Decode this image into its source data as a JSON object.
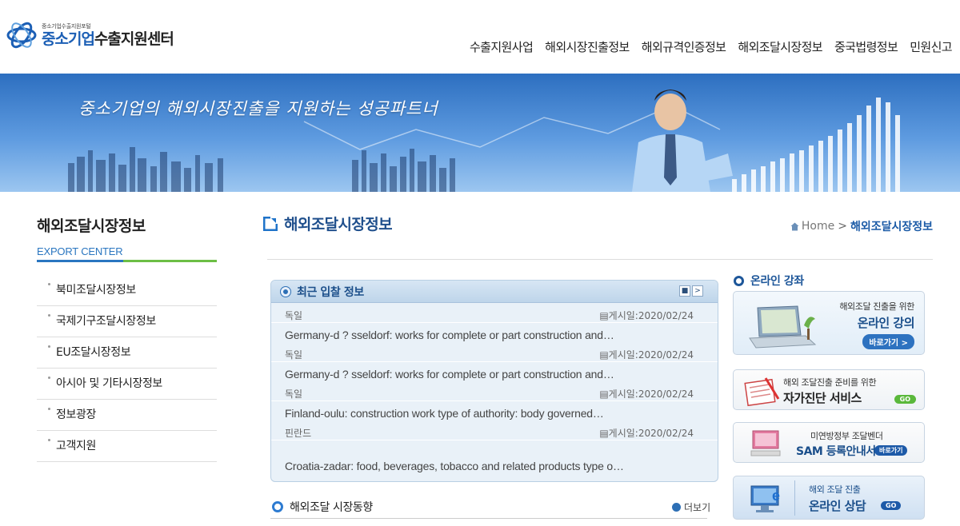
{
  "header": {
    "logo_small": "중소기업수출지원포털",
    "logo_main_1": "중소기업",
    "logo_main_2": "수출지원센터",
    "nav": [
      "수출지원사업",
      "해외시장진출정보",
      "해외규격인증정보",
      "해외조달시장정보",
      "중국법령정보",
      "민원신고"
    ]
  },
  "banner": {
    "slogan": "중소기업의 해외시장진출을 지원하는 성공파트너"
  },
  "sidebar": {
    "title": "해외조달시장정보",
    "subtitle": "EXPORT CENTER",
    "items": [
      "북미조달시장정보",
      "국제기구조달시장정보",
      "EU조달시장정보",
      "아시아 및 기타시장정보",
      "정보광장",
      "고객지원"
    ]
  },
  "content": {
    "title": "해외조달시장정보",
    "breadcrumb_home": "Home",
    "breadcrumb_current": "해외조달시장정보"
  },
  "bids": {
    "title": "최근 입찰 정보",
    "ctrl_stop": "■",
    "ctrl_next": ">",
    "rows": [
      {
        "country": "독일",
        "date": "게시일:2020/02/24"
      },
      {
        "title": "Germany-d ? sseldorf: works for complete or part construction and…",
        "country": "독일",
        "date": "게시일:2020/02/24"
      },
      {
        "title": "Germany-d ? sseldorf: works for complete or part construction and…",
        "country": "독일",
        "date": "게시일:2020/02/24"
      },
      {
        "title": "Finland-oulu: construction work type of authority: body governed…",
        "country": "핀란드",
        "date": "게시일:2020/02/24"
      },
      {
        "title": "Croatia-zadar: food, beverages, tobacco and related products type o…"
      }
    ]
  },
  "market": {
    "title": "해외조달 시장동향",
    "more": "더보기"
  },
  "right": {
    "online_title": "온라인 강좌",
    "b1_small": "해외조달 진출을 위한",
    "b1_big": "온라인 강의",
    "b1_btn": "바로가기 >",
    "b2_small": "해외 조달진출 준비를 위한",
    "b2_big": "자가진단 서비스",
    "b2_btn": "GO",
    "b3_small": "미연방정부 조달벤더",
    "b3_big": "SAM 등록안내서",
    "b3_btn": "바로가기",
    "b4_small": "해외 조달 진출",
    "b4_big": "온라인 상담",
    "b4_btn": "GO"
  },
  "colors": {
    "brand": "#1c5fb5",
    "accent_green": "#6cbe45",
    "panel": "#e9f1f8"
  }
}
